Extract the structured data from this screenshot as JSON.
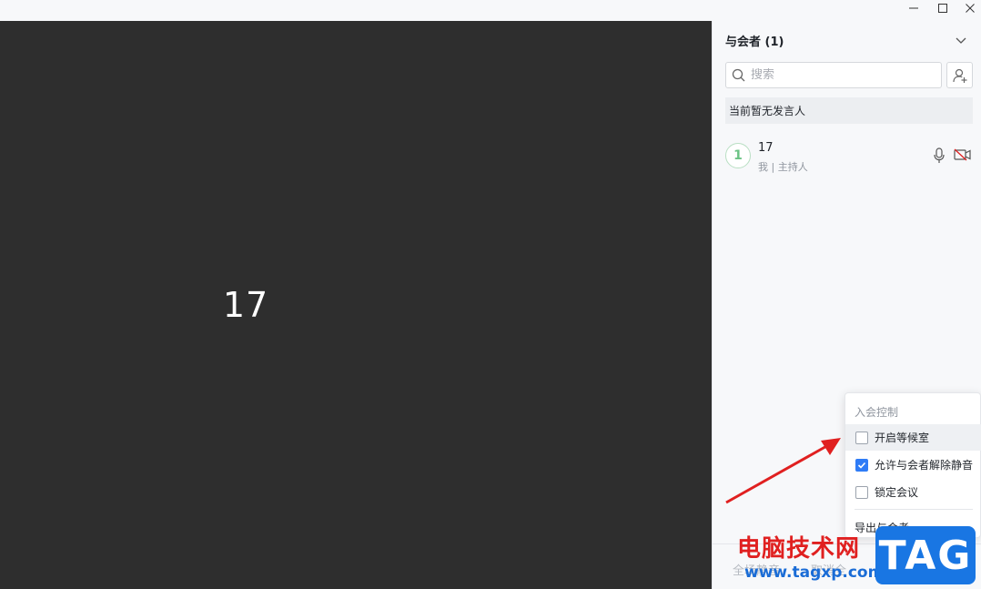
{
  "window": {
    "controls": [
      "minimize-icon",
      "maximize-icon",
      "close-icon"
    ]
  },
  "video": {
    "participant_name": "17",
    "background_color": "#2e2e2e"
  },
  "panel": {
    "title": "与会者 (1)",
    "search": {
      "placeholder": "搜索",
      "value": ""
    },
    "speaker_status": "当前暂无发言人",
    "members": [
      {
        "name": "17",
        "role": "我 | 主持人",
        "avatar_initial": "1",
        "mic": "mic-icon",
        "camera": "camera-off-icon"
      }
    ],
    "bottom_buttons": [
      "全场静音",
      "取消全"
    ]
  },
  "menu": {
    "header": "入会控制",
    "items": [
      {
        "label": "开启等候室",
        "checked": false,
        "highlighted": true
      },
      {
        "label": "允许与会者解除静音",
        "checked": true,
        "highlighted": false
      },
      {
        "label": "锁定会议",
        "checked": false,
        "highlighted": false
      }
    ],
    "export_label": "导出与会者"
  },
  "watermark": {
    "text": "电脑技术网",
    "url": "www.tagxp.com",
    "tag": "TAG"
  },
  "colors": {
    "accent": "#2f7cf6",
    "annotation_arrow": "#e02020",
    "avatar_ring": "#b9dfc3"
  }
}
